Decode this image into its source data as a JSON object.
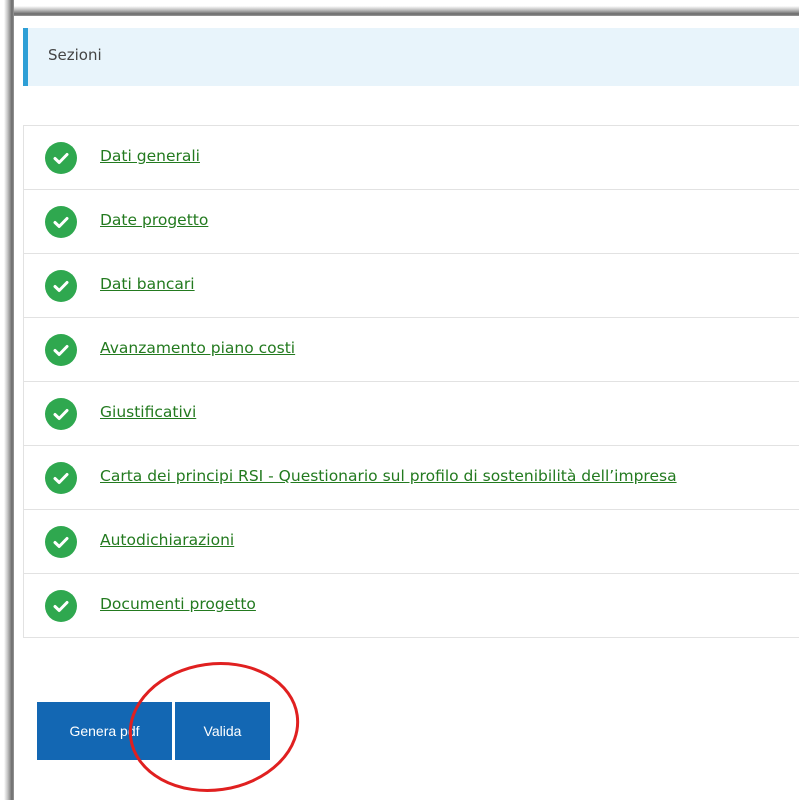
{
  "section": {
    "title": "Sezioni"
  },
  "items": [
    {
      "label": "Dati generali",
      "status": "complete"
    },
    {
      "label": "Date progetto",
      "status": "complete"
    },
    {
      "label": "Dati bancari",
      "status": "complete"
    },
    {
      "label": "Avanzamento piano costi",
      "status": "complete"
    },
    {
      "label": "Giustificativi",
      "status": "complete"
    },
    {
      "label": "Carta dei principi RSI - Questionario sul profilo di sostenibilità dell’impresa",
      "status": "complete"
    },
    {
      "label": "Autodichiarazioni",
      "status": "complete"
    },
    {
      "label": "Documenti progetto",
      "status": "complete"
    }
  ],
  "buttons": {
    "genera_pdf": "Genera pdf",
    "valida": "Valida"
  },
  "colors": {
    "accent": "#2e9fd6",
    "check": "#2fa84f",
    "link": "#237a1f",
    "button": "#1367b3",
    "annotation": "#e02020"
  },
  "icons": {
    "check": "check-circle-icon"
  }
}
